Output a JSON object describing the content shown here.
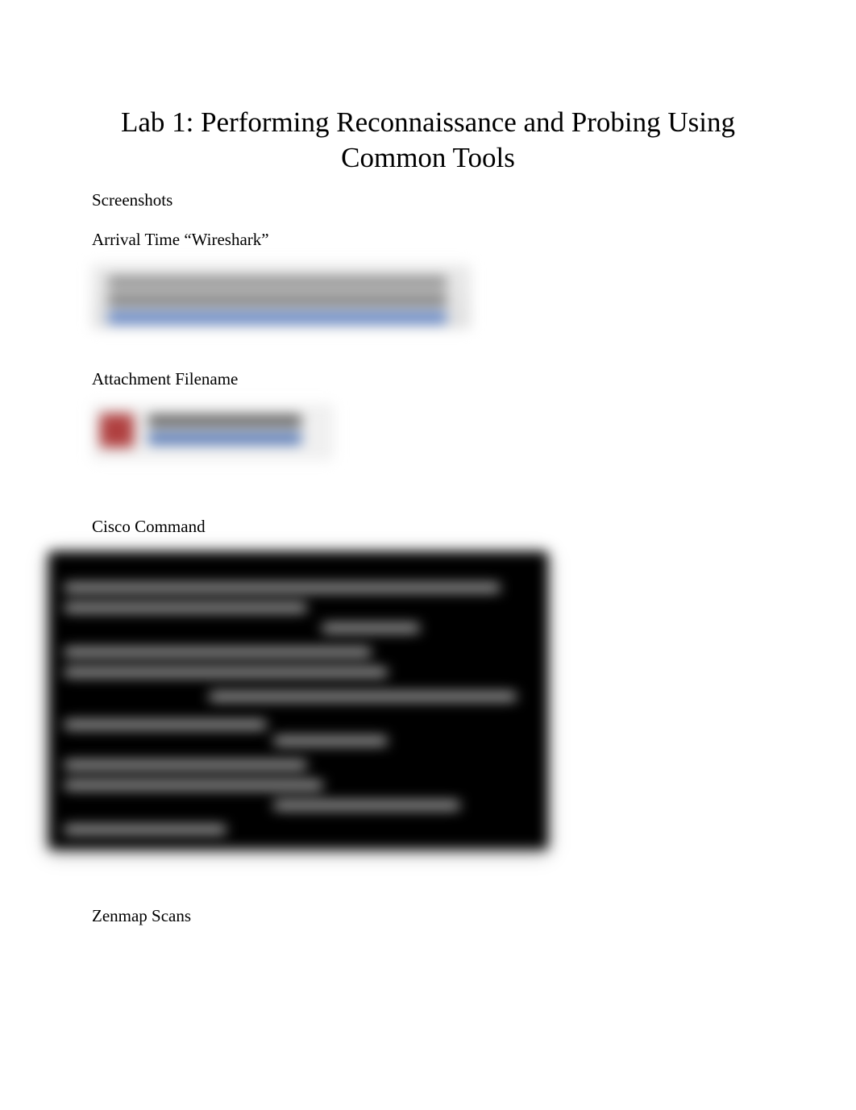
{
  "title": "Lab 1: Performing Reconnaissance and Probing Using Common Tools",
  "sections": {
    "screenshots_label": "Screenshots",
    "arrival_time": "Arrival Time “Wireshark”",
    "attachment_filename": "Attachment Filename",
    "cisco_command": "Cisco Command",
    "zenmap_scans": "Zenmap Scans"
  }
}
